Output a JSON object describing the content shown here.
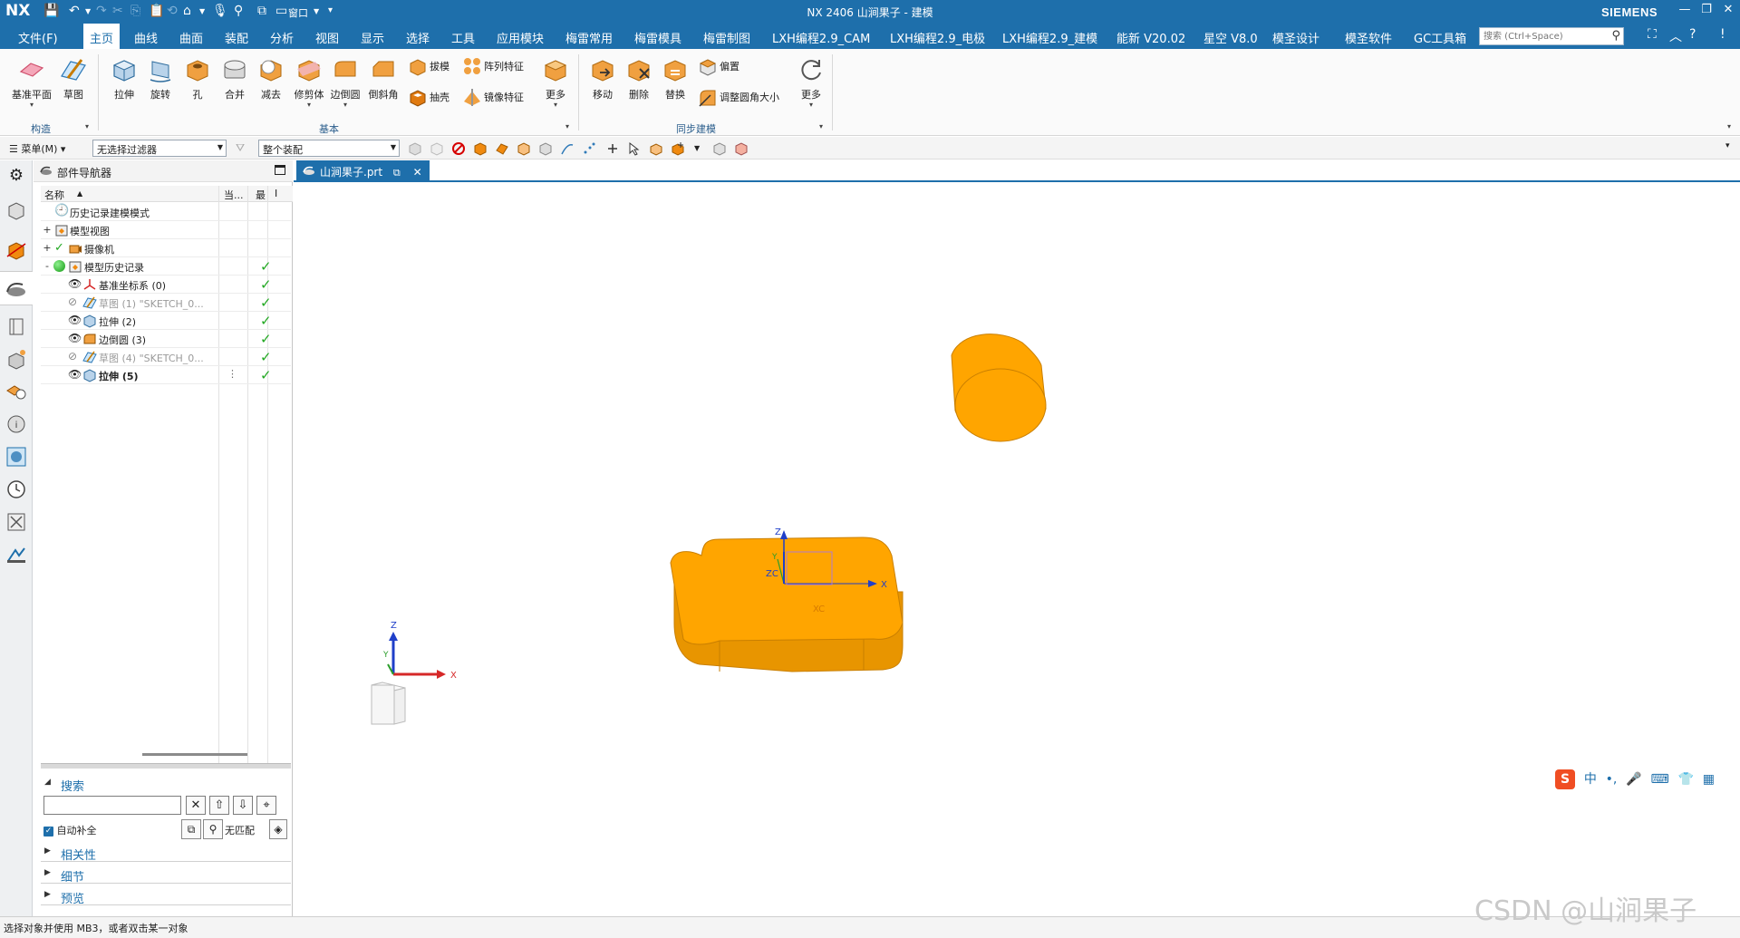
{
  "titlebar": {
    "logo": "NX",
    "title": "NX 2406 山涧果子 - 建模",
    "brand": "SIEMENS",
    "window_label": "窗口"
  },
  "menubar": {
    "items": [
      "文件(F)",
      "主页",
      "曲线",
      "曲面",
      "装配",
      "分析",
      "视图",
      "显示",
      "选择",
      "工具",
      "应用模块",
      "梅雷常用",
      "梅雷模具",
      "梅雷制图",
      "LXH编程2.9_CAM",
      "LXH编程2.9_电极",
      "LXH编程2.9_建模",
      "能新 V20.02",
      "星空 V8.0",
      "模圣设计",
      "模圣软件",
      "GC工具箱"
    ],
    "active_index": 1,
    "search_placeholder": "搜索 (Ctrl+Space)"
  },
  "ribbon": {
    "buttons": {
      "datum_plane": "基准平面",
      "sketch": "草图",
      "extrude": "拉伸",
      "revolve": "旋转",
      "hole": "孔",
      "unite": "合并",
      "subtract": "减去",
      "trim_body": "修剪体",
      "edge_blend": "边倒圆",
      "chamfer": "倒斜角",
      "draft": "拔模",
      "pattern_feature": "阵列特征",
      "shell": "抽壳",
      "mirror_feature": "镜像特征",
      "more_basic": "更多",
      "move": "移动",
      "delete": "删除",
      "replace": "替换",
      "offset": "偏置",
      "resize_blend": "调整圆角大小",
      "more_sync": "更多"
    },
    "groups": {
      "construct": "构造",
      "basic": "基本",
      "sync": "同步建模"
    }
  },
  "selbar": {
    "menu": "菜单(M)",
    "filter": "无选择过滤器",
    "scope": "整个装配"
  },
  "navigator": {
    "title": "部件导航器",
    "columns": [
      "名称",
      "当...",
      "最",
      "I"
    ],
    "rows": [
      {
        "label": "历史记录建模模式",
        "style": "normal",
        "check": false,
        "expand": ""
      },
      {
        "label": "模型视图",
        "style": "normal",
        "check": false,
        "expand": "+"
      },
      {
        "label": "摄像机",
        "style": "normal",
        "check": false,
        "expand": "+"
      },
      {
        "label": "模型历史记录",
        "style": "normal",
        "check": true,
        "expand": "-"
      },
      {
        "label": "基准坐标系 (0)",
        "style": "normal",
        "check": true,
        "expand": ""
      },
      {
        "label": "草图 (1) \"SKETCH_0...",
        "style": "dim",
        "check": true,
        "expand": ""
      },
      {
        "label": "拉伸 (2)",
        "style": "normal",
        "check": true,
        "expand": ""
      },
      {
        "label": "边倒圆 (3)",
        "style": "normal",
        "check": true,
        "expand": ""
      },
      {
        "label": "草图 (4) \"SKETCH_0...",
        "style": "dim",
        "check": true,
        "expand": ""
      },
      {
        "label": "拉伸 (5)",
        "style": "bold",
        "check": true,
        "expand": ""
      }
    ],
    "search": {
      "header": "搜索",
      "autofill_label": "自动补全",
      "no_match": "无匹配"
    },
    "sections": [
      "相关性",
      "细节",
      "预览"
    ]
  },
  "doc_tab": {
    "label": "山涧果子.prt"
  },
  "viewport": {
    "axis_labels": {
      "z": "Z",
      "zc": "ZC",
      "y": "Y",
      "xc": "XC",
      "x": "X"
    },
    "triad_labels": {
      "z": "Z",
      "y": "Y",
      "x": "X"
    },
    "colors": {
      "body": "#ffa500",
      "body_edge": "#c97f00",
      "side": "#e89500",
      "x_axis": "#d62828",
      "y_axis": "#2a9d2a",
      "z_axis": "#1f3fc9"
    }
  },
  "ime_chars": [
    "中",
    "•,",
    "🎤",
    "⌨",
    "👕",
    "▦"
  ],
  "statusbar": {
    "message": "选择对象并使用 MB3，或者双击某一对象"
  },
  "watermark": "CSDN @山涧果子"
}
